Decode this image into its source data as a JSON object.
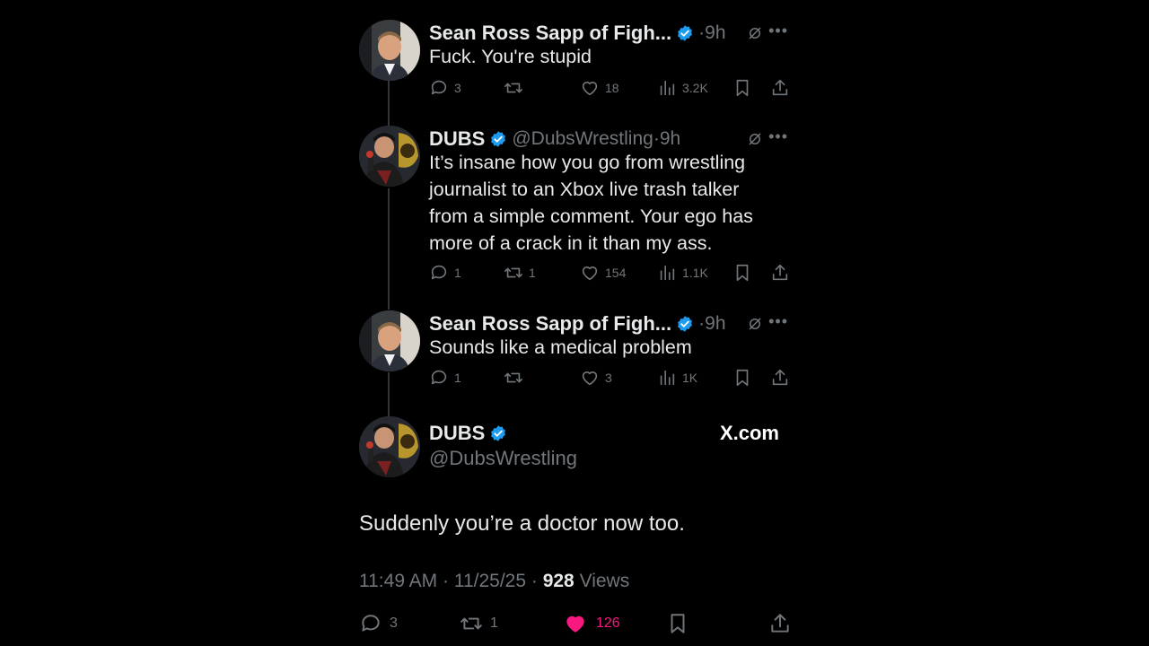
{
  "replies": [
    {
      "name": "Sean Ross Sapp of Figh...",
      "handle": "",
      "time": "9h",
      "text": [
        "Fuck. You're stupid"
      ],
      "replies": "3",
      "retweets": "",
      "likes": "18",
      "views": "3.2K"
    },
    {
      "name": "DUBS",
      "handle": "@DubsWrestling",
      "time": "9h",
      "text": [
        "It’s insane how you go from wrestling",
        "journalist to an Xbox live trash talker",
        "from a simple comment. Your ego has",
        "more of a crack in it than my ass."
      ],
      "replies": "1",
      "retweets": "1",
      "likes": "154",
      "views": "1.1K"
    },
    {
      "name": "Sean Ross Sapp of Figh...",
      "handle": "",
      "time": "9h",
      "text": [
        "Sounds like a medical problem"
      ],
      "replies": "1",
      "retweets": "",
      "likes": "3",
      "views": "1K"
    }
  ],
  "main": {
    "name": "DUBS",
    "handle": "@DubsWrestling",
    "site": "X.com",
    "text": "Suddenly you’re a doctor now too.",
    "time": "11:49 AM · 11/25/25 · ",
    "views_count": "928",
    "views_label": " Views",
    "replies": "3",
    "retweets": "1",
    "likes": "126"
  },
  "separator": "·",
  "colors": {
    "verified": "#1d9bf0",
    "like_active": "#f91880",
    "muted": "#71767b"
  },
  "icons": [
    "reply-icon",
    "retweet-icon",
    "like-icon",
    "views-icon",
    "bookmark-icon",
    "share-icon",
    "grok-icon",
    "more-icon",
    "verified-icon"
  ]
}
